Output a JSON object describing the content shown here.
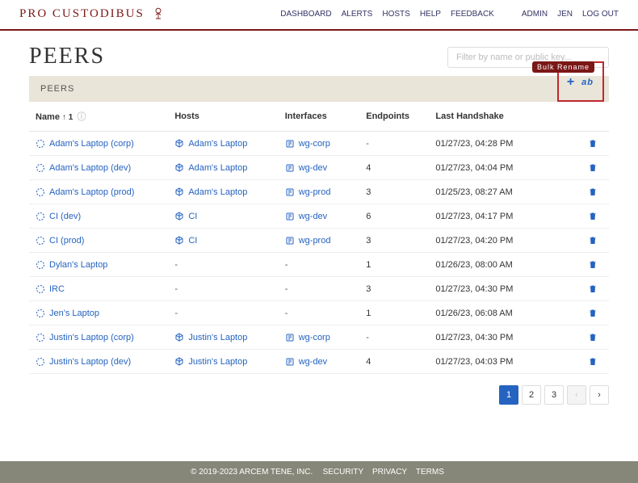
{
  "brand": "PRO CUSTODIBUS",
  "nav": {
    "dashboard": "DASHBOARD",
    "alerts": "ALERTS",
    "hosts": "HOSTS",
    "help": "HELP",
    "feedback": "FEEDBACK",
    "admin": "ADMIN",
    "user": "JEN",
    "logout": "LOG OUT"
  },
  "page": {
    "title": "PEERS",
    "panel_label": "PEERS",
    "filter_placeholder": "Filter by name or public key...",
    "tooltip": "Bulk Rename"
  },
  "columns": {
    "name": "Name",
    "sort": "↑ 1",
    "hosts": "Hosts",
    "interfaces": "Interfaces",
    "endpoints": "Endpoints",
    "handshake": "Last Handshake"
  },
  "rows": [
    {
      "name": "Adam's Laptop (corp)",
      "host": "Adam's Laptop",
      "iface": "wg-corp",
      "ep": "-",
      "hs": "01/27/23, 04:28 PM"
    },
    {
      "name": "Adam's Laptop (dev)",
      "host": "Adam's Laptop",
      "iface": "wg-dev",
      "ep": "4",
      "hs": "01/27/23, 04:04 PM"
    },
    {
      "name": "Adam's Laptop (prod)",
      "host": "Adam's Laptop",
      "iface": "wg-prod",
      "ep": "3",
      "hs": "01/25/23, 08:27 AM"
    },
    {
      "name": "CI (dev)",
      "host": "CI",
      "iface": "wg-dev",
      "ep": "6",
      "hs": "01/27/23, 04:17 PM"
    },
    {
      "name": "CI (prod)",
      "host": "CI",
      "iface": "wg-prod",
      "ep": "3",
      "hs": "01/27/23, 04:20 PM"
    },
    {
      "name": "Dylan's Laptop",
      "host": "-",
      "iface": "-",
      "ep": "1",
      "hs": "01/26/23, 08:00 AM"
    },
    {
      "name": "IRC",
      "host": "-",
      "iface": "-",
      "ep": "3",
      "hs": "01/27/23, 04:30 PM"
    },
    {
      "name": "Jen's Laptop",
      "host": "-",
      "iface": "-",
      "ep": "1",
      "hs": "01/26/23, 06:08 AM"
    },
    {
      "name": "Justin's Laptop (corp)",
      "host": "Justin's Laptop",
      "iface": "wg-corp",
      "ep": "-",
      "hs": "01/27/23, 04:30 PM"
    },
    {
      "name": "Justin's Laptop (dev)",
      "host": "Justin's Laptop",
      "iface": "wg-dev",
      "ep": "4",
      "hs": "01/27/23, 04:03 PM"
    }
  ],
  "pagination": {
    "pages": [
      "1",
      "2",
      "3"
    ],
    "active": 0
  },
  "footer": {
    "copyright": "© 2019-2023 ARCEM TENE, INC.",
    "security": "SECURITY",
    "privacy": "PRIVACY",
    "terms": "TERMS"
  }
}
